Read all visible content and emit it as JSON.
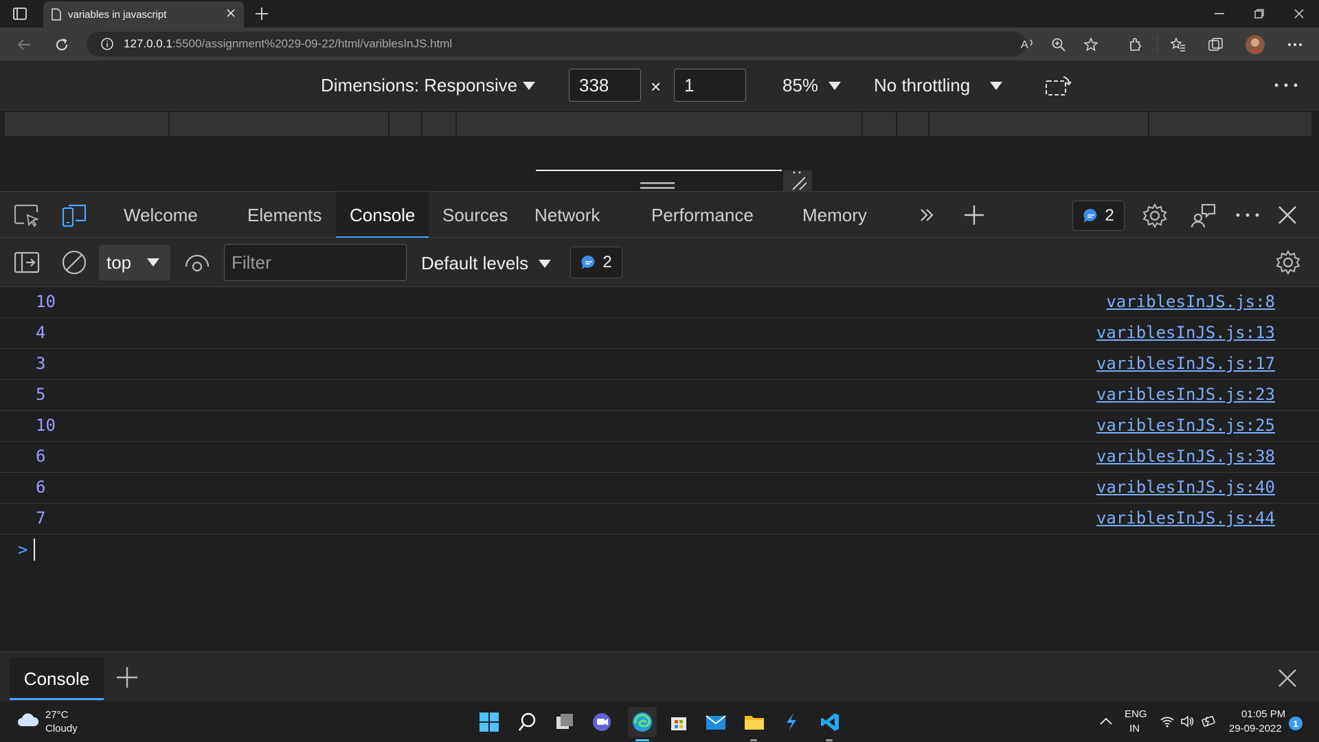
{
  "browser": {
    "tab_title": "variables in javascript",
    "url_host": "127.0.0.1",
    "url_path": ":5500/assignment%2029-09-22/html/variblesInJS.html"
  },
  "device_toolbar": {
    "dimensions_label": "Dimensions: Responsive",
    "width": "338",
    "times": "×",
    "height": "1",
    "zoom": "85%",
    "throttling": "No throttling"
  },
  "devtools": {
    "tabs": [
      "Welcome",
      "Elements",
      "Console",
      "Sources",
      "Network",
      "Performance",
      "Memory"
    ],
    "active_tab": "Console",
    "issues_count": "2"
  },
  "console_toolbar": {
    "context": "top",
    "filter_placeholder": "Filter",
    "levels": "Default levels",
    "messages_count": "2"
  },
  "console": {
    "rows": [
      {
        "value": "10",
        "source": "variblesInJS.js:8"
      },
      {
        "value": "4",
        "source": "variblesInJS.js:13"
      },
      {
        "value": "3",
        "source": "variblesInJS.js:17"
      },
      {
        "value": "5",
        "source": "variblesInJS.js:23"
      },
      {
        "value": "10",
        "source": "variblesInJS.js:25"
      },
      {
        "value": "6",
        "source": "variblesInJS.js:38"
      },
      {
        "value": "6",
        "source": "variblesInJS.js:40"
      },
      {
        "value": "7",
        "source": "variblesInJS.js:44"
      }
    ],
    "prompt": ">"
  },
  "drawer": {
    "tab": "Console"
  },
  "taskbar": {
    "weather_temp": "27°C",
    "weather_desc": "Cloudy",
    "lang_top": "ENG",
    "lang_bottom": "IN",
    "time": "01:05 PM",
    "date": "29-09-2022",
    "notification_count": "1"
  },
  "colors": {
    "accent": "#4aa3ff",
    "console_value": "#9b9bff",
    "link": "#7cacf8"
  }
}
